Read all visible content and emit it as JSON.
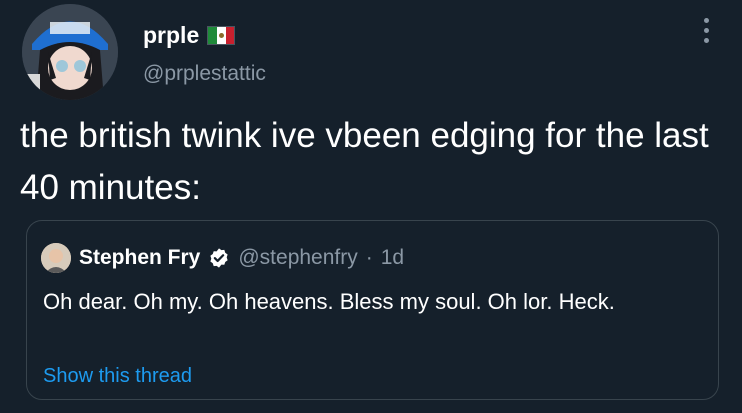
{
  "author": {
    "display_name": "prple",
    "handle": "@prplestattic",
    "avatar_icon": "anime-avatar-with-cap-icon",
    "badge_icon": "mexico-flag-icon"
  },
  "tweet": {
    "text": "the british twink ive vbeen edging for the last 40 minutes:"
  },
  "quoted_tweet": {
    "display_name": "Stephen Fry",
    "handle": "@stephenfry",
    "separator": "·",
    "time": "1d",
    "text": "Oh dear. Oh my. Oh heavens. Bless my soul. Oh lor. Heck.",
    "show_thread_label": "Show this thread",
    "verified_icon": "verified-badge-icon"
  },
  "colors": {
    "background": "#15202b",
    "text": "#ffffff",
    "muted": "#8b98a5",
    "link": "#1d9bf0",
    "border": "#38444d"
  }
}
